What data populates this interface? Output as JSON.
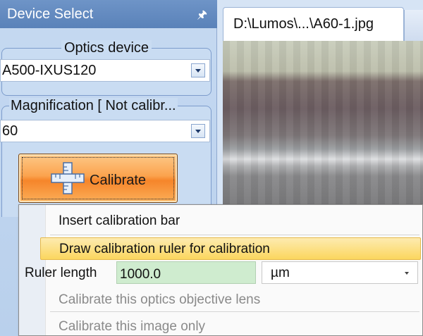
{
  "panel": {
    "title": "Device Select",
    "pin_icon": "pin-icon"
  },
  "optics": {
    "group_title": "Optics device",
    "selected": "A500-IXUS120"
  },
  "magnification": {
    "group_title": "Magnification [ Not calibr...",
    "selected": "60"
  },
  "calibrate": {
    "label": "Calibrate",
    "icon": "ruler-icon"
  },
  "document": {
    "tab_title": "D:\\Lumos\\...\\A60-1.jpg"
  },
  "menu": {
    "insert_bar": "Insert calibration bar",
    "draw_ruler": "Draw calibration ruler for calibration",
    "ruler_length_label": "Ruler length",
    "ruler_length_value": "1000.0",
    "unit": "µm",
    "calibrate_lens": "Calibrate this optics objective lens",
    "calibrate_image": "Calibrate this image only"
  },
  "colors": {
    "panel_header": "#5a82b9",
    "calibrate_button": "#f6852a",
    "menu_highlight": "#fbd65e",
    "ruler_input_bg": "#cfeccf"
  }
}
